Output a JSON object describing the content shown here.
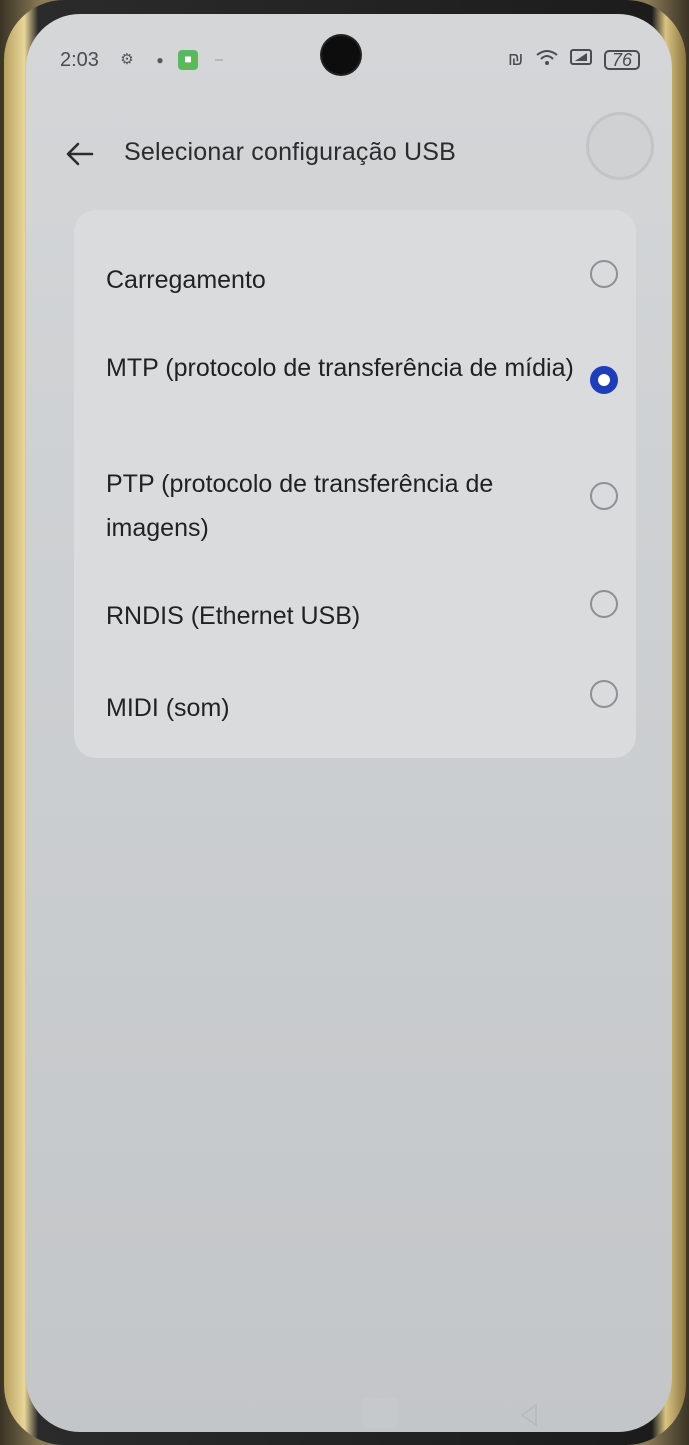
{
  "status_bar": {
    "time": "2:03",
    "battery": "76"
  },
  "header": {
    "title": "Selecionar configuração USB"
  },
  "usb_options": [
    {
      "label": "Carregamento",
      "selected": false
    },
    {
      "label": "MTP (protocolo de transferência de mídia)",
      "selected": true
    },
    {
      "label": "PTP (protocolo de transferência de imagens)",
      "selected": false
    },
    {
      "label": "RNDIS (Ethernet USB)",
      "selected": false
    },
    {
      "label": "MIDI (som)",
      "selected": false
    }
  ],
  "icons": {
    "back": "arrow-left-icon",
    "status": [
      "gear-icon",
      "bug-icon",
      "app-icon",
      "nfc-icon",
      "wifi-icon",
      "signal-icon",
      "battery-icon"
    ]
  },
  "colors": {
    "accent": "#1f3fb8",
    "screen_bg": "#d4d6d8",
    "card_bg": "#d9dbdd"
  }
}
